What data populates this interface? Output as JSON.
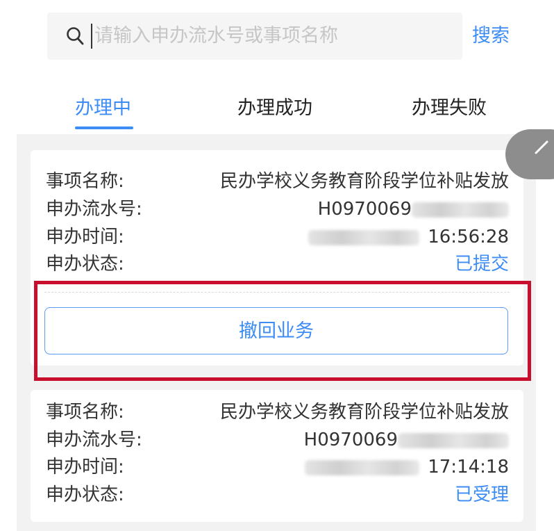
{
  "search": {
    "placeholder": "请输入申办流水号或事项名称",
    "button_label": "搜索"
  },
  "tabs": [
    {
      "label": "办理中",
      "active": true
    },
    {
      "label": "办理成功",
      "active": false
    },
    {
      "label": "办理失败",
      "active": false
    }
  ],
  "field_labels": {
    "item_name": "事项名称:",
    "serial_no": "申办流水号:",
    "apply_time": "申办时间:",
    "status": "申办状态:"
  },
  "records": [
    {
      "item_name": "民办学校义务教育阶段学位补贴发放",
      "serial_no": "H0970069",
      "apply_time": "16:56:28",
      "status": "已提交",
      "action_label": "撤回业务"
    },
    {
      "item_name": "民办学校义务教育阶段学位补贴发放",
      "serial_no": "H0970069",
      "apply_time": "17:14:18",
      "status": "已受理"
    }
  ],
  "colors": {
    "accent": "#3d8cf4",
    "highlight_border": "#c8102e",
    "list_background": "#f2f2f3"
  },
  "icons": {
    "search": "search-icon",
    "scroll_top": "arrow-icon"
  }
}
